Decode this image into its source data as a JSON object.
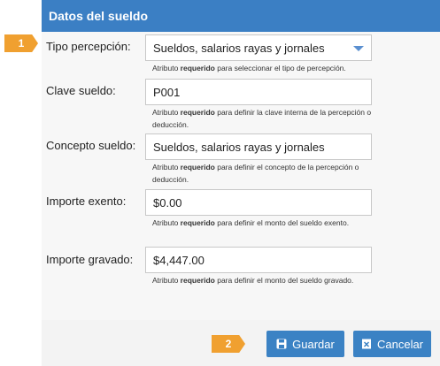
{
  "panel": {
    "title": "Datos del sueldo"
  },
  "steps": {
    "one": "1",
    "two": "2"
  },
  "fields": {
    "tipo": {
      "label": "Tipo percepción:",
      "value": "Sueldos, salarios  rayas y jornales",
      "hint_pre": "Atributo ",
      "hint_bold": "requerido",
      "hint_post": " para seleccionar el tipo de percepción."
    },
    "clave": {
      "label": "Clave sueldo:",
      "value": "P001",
      "hint_pre": "Atributo ",
      "hint_bold": "requerido",
      "hint_post": " para definir la clave interna de la percepción o deducción."
    },
    "concepto": {
      "label": "Concepto sueldo:",
      "value": "Sueldos, salarios  rayas y jornales",
      "hint_pre": "Atributo ",
      "hint_bold": "requerido",
      "hint_post": " para definir el concepto de la percepción o deducción."
    },
    "exento": {
      "label": "Importe exento:",
      "value": "$0.00",
      "hint_pre": "Atributo ",
      "hint_bold": "requerido",
      "hint_post": " para definir el monto del sueldo exento."
    },
    "gravado": {
      "label": "Importe gravado:",
      "value": "$4,447.00",
      "hint_pre": "Atributo ",
      "hint_bold": "requerido",
      "hint_post": " para definir el monto del sueldo gravado."
    }
  },
  "buttons": {
    "save": "Guardar",
    "cancel": "Cancelar"
  },
  "colors": {
    "header": "#3b7fc4",
    "badge": "#f0a030",
    "button": "#3b82c4"
  }
}
